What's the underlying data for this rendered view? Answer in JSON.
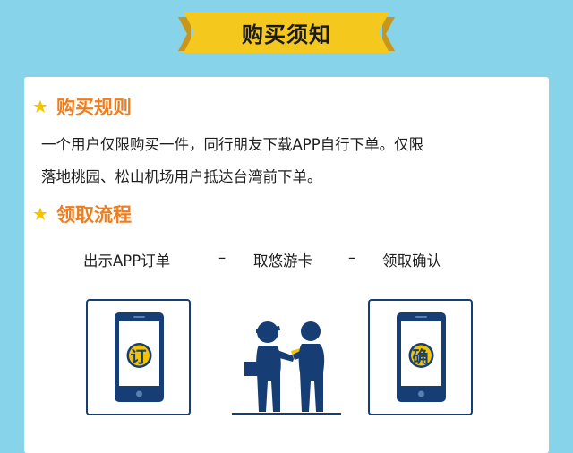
{
  "banner": {
    "title": "购买须知",
    "color": "#f5c81d",
    "shade_color": "#c8961a"
  },
  "sections": {
    "rules": {
      "icon": "star-icon",
      "title": "购买规则",
      "line1": "一个用户仅限购买一件，同行朋友下载APP自行下单。仅限",
      "line2": "落地桃园、松山机场用户抵达台湾前下单。"
    },
    "process": {
      "icon": "star-icon",
      "title": "领取流程",
      "steps": [
        "出示APP订单",
        "取悠游卡",
        "领取确认"
      ],
      "separator": "–"
    }
  },
  "illustrations": {
    "order_phone": {
      "icon": "phone-icon",
      "char": "订"
    },
    "handover": {
      "icon": "handover-people-icon"
    },
    "confirm_phone": {
      "icon": "phone-icon",
      "char": "确"
    }
  },
  "colors": {
    "background": "#86d3ea",
    "accent": "#f07d1d",
    "navy": "#173e74",
    "coin": "#f5c400"
  }
}
